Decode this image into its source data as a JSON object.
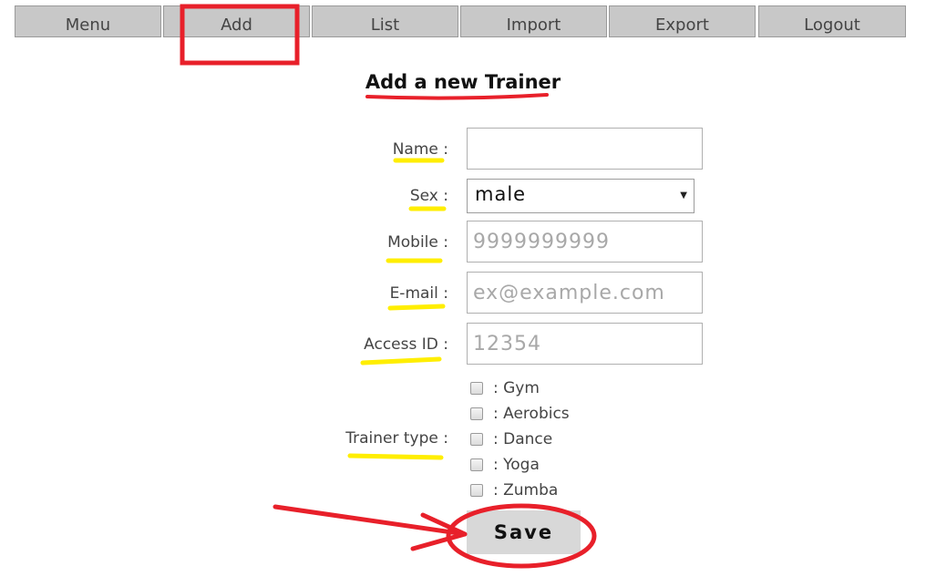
{
  "nav": {
    "items": [
      {
        "label": "Menu"
      },
      {
        "label": "Add"
      },
      {
        "label": "List"
      },
      {
        "label": "Import"
      },
      {
        "label": "Export"
      },
      {
        "label": "Logout"
      }
    ]
  },
  "form": {
    "title": "Add a new Trainer",
    "name": {
      "label": "Name :",
      "value": "",
      "placeholder": ""
    },
    "sex": {
      "label": "Sex :",
      "selected": "male"
    },
    "mobile": {
      "label": "Mobile :",
      "placeholder": "9999999999"
    },
    "email": {
      "label": "E-mail :",
      "placeholder": "ex@example.com"
    },
    "access_id": {
      "label": "Access ID :",
      "placeholder": "12354"
    },
    "trainer_type": {
      "label": "Trainer type :",
      "options": [
        {
          "label": ": Gym",
          "checked": false
        },
        {
          "label": ": Aerobics",
          "checked": false
        },
        {
          "label": ": Dance",
          "checked": false
        },
        {
          "label": ": Yoga",
          "checked": false
        },
        {
          "label": ": Zumba",
          "checked": false
        }
      ]
    },
    "save_label": "Save"
  },
  "annotations": {
    "box_color": "#e8202a",
    "underline_yellow": "#ffee00",
    "underline_red": "#e8202a"
  }
}
